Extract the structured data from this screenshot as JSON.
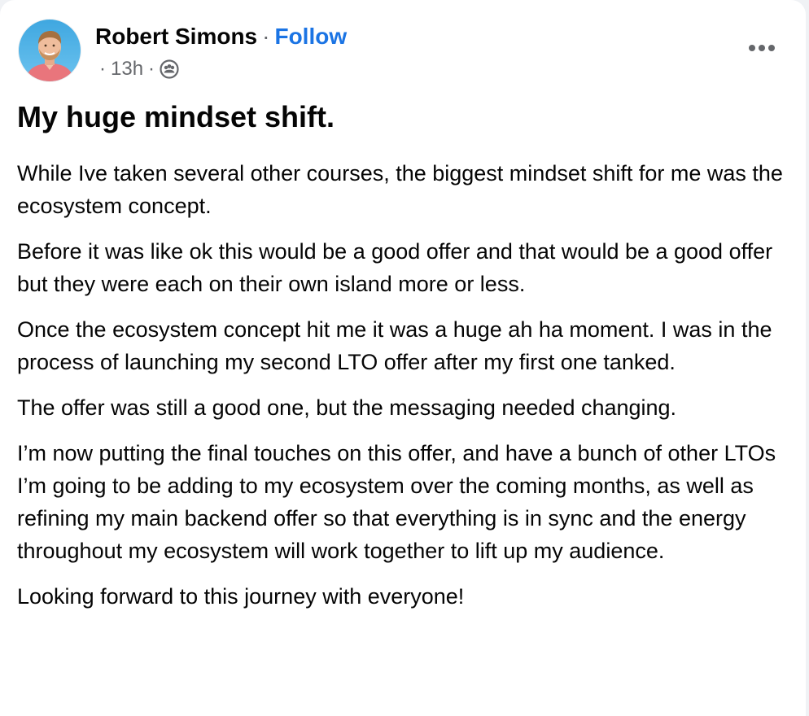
{
  "post": {
    "author": "Robert Simons",
    "separator": "·",
    "follow_label": "Follow",
    "time_prefix": "·",
    "time": "13h",
    "time_suffix": "·",
    "audience_icon": "group-audience-icon",
    "more_icon": "more-options-icon",
    "title": "My huge mindset shift.",
    "paragraphs": [
      "While Ive taken several other courses, the biggest mindset shift for me was the ecosystem concept.",
      "Before it was like ok this would be a good offer and that would be a good offer but they were each on their own island more or less.",
      "Once the ecosystem concept hit me it was a huge ah ha moment. I was in the process of launching my second LTO offer after my first one tanked.",
      "The offer was still a good one, but the messaging needed changing.",
      "I’m now putting the final touches on this offer, and have a bunch of other LTOs I’m going to be adding to my ecosystem over the coming months, as well as refining my main backend offer so that everything is in sync and the energy throughout my ecosystem will work together to lift up my audience.",
      "Looking forward to this journey with everyone!"
    ]
  },
  "colors": {
    "link": "#1b74e4",
    "secondary_text": "#65676b",
    "primary_text": "#050505",
    "card_background": "#ffffff"
  }
}
